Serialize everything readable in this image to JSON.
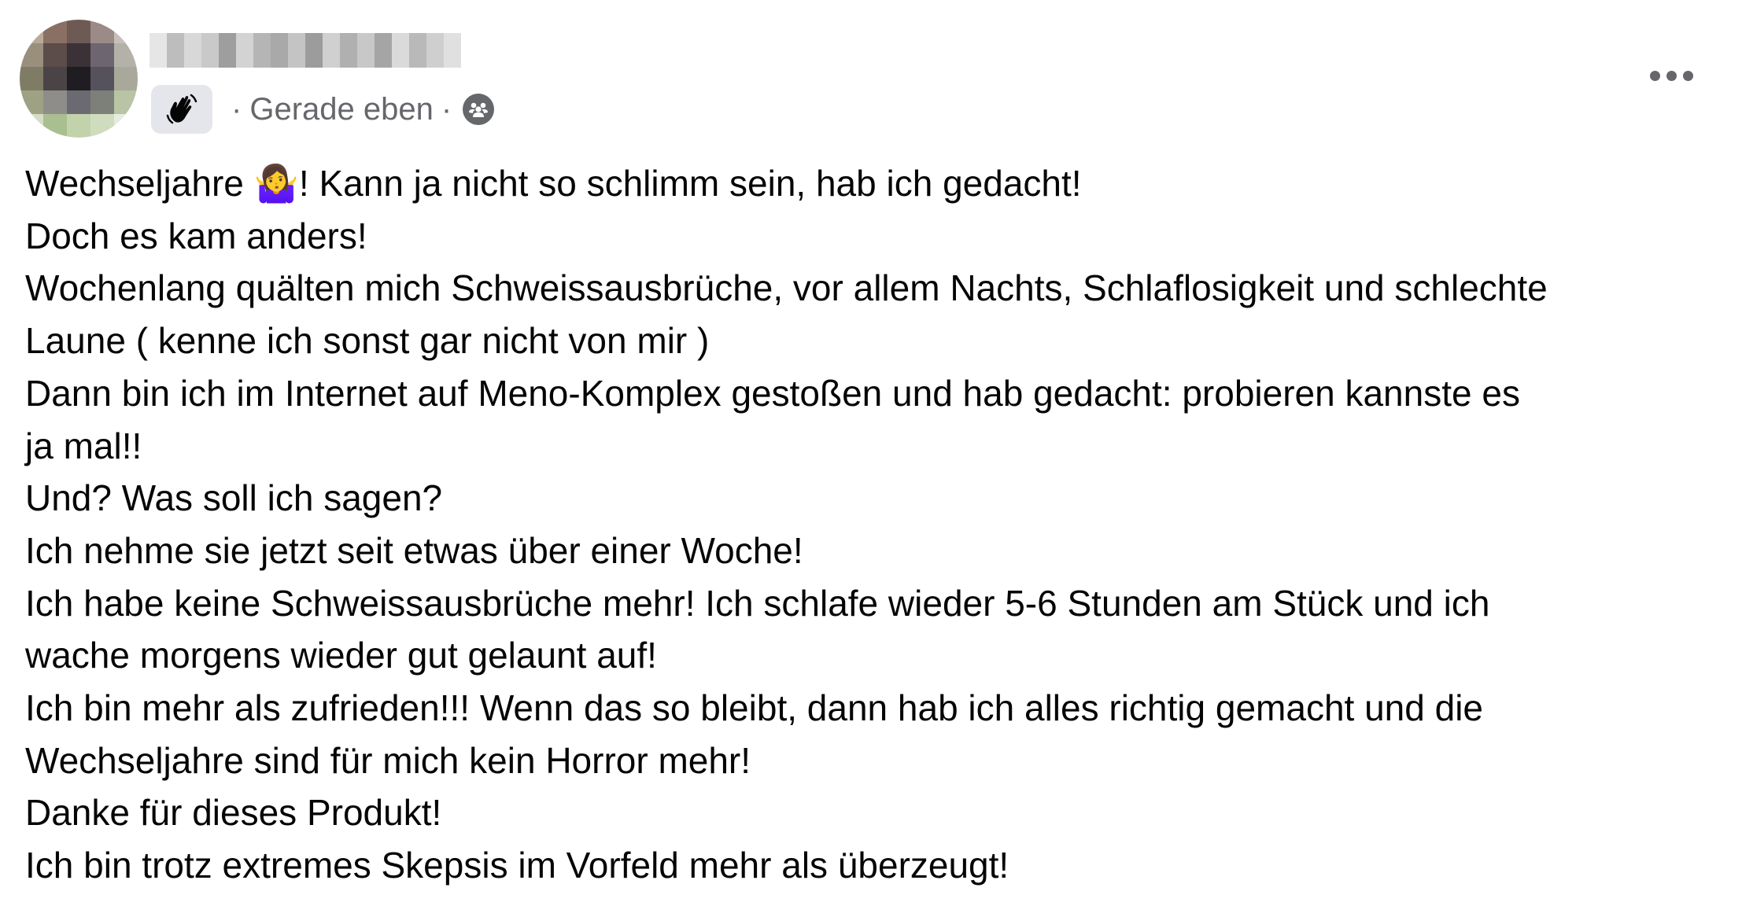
{
  "post": {
    "timestamp": "Gerade eben",
    "separator": "·",
    "more_label": "•••",
    "lines": [
      [
        "Wechseljahre ",
        "🤷‍♀️",
        "! Kann ja nicht so schlimm sein, hab ich gedacht!"
      ],
      [
        "Doch es kam anders!"
      ],
      [
        "Wochenlang quälten mich Schweissausbrüche, vor allem Nachts, Schlaflosigkeit und schlechte"
      ],
      [
        "Laune ( kenne ich sonst gar nicht von mir )"
      ],
      [
        "Dann bin ich im Internet auf Meno-Komplex gestoßen und hab gedacht: probieren kannste es"
      ],
      [
        "ja mal!!"
      ],
      [
        "Und? Was soll ich sagen?"
      ],
      [
        "Ich nehme sie jetzt seit etwas über einer Woche!"
      ],
      [
        "Ich habe keine Schweissausbrüche mehr! Ich schlafe wieder 5-6 Stunden am Stück und ich"
      ],
      [
        "wache morgens wieder gut gelaunt auf!"
      ],
      [
        "Ich bin mehr als zufrieden!!! Wenn das so bleibt, dann hab ich alles richtig gemacht und die"
      ],
      [
        "Wechseljahre sind für mich kein Horror mehr!"
      ],
      [
        "Danke für dieses Produkt!"
      ],
      [
        "Ich bin trotz extremes Skepsis im Vorfeld mehr als überzeugt!"
      ]
    ]
  },
  "icons": {
    "badge": "waving-hand-icon",
    "audience": "group-icon",
    "more": "more-options-icon"
  },
  "colors": {
    "text": "#050505",
    "secondary_text": "#65676b",
    "badge_bg": "#e4e6eb"
  }
}
